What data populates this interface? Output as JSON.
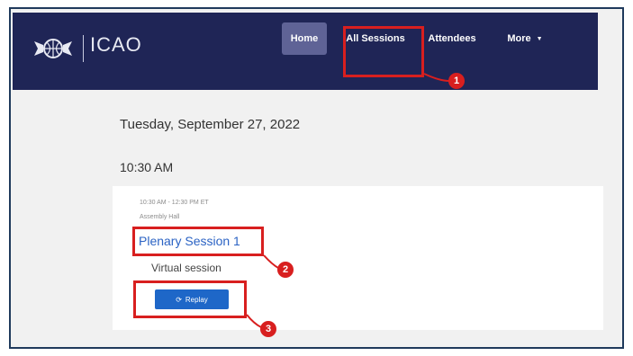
{
  "app": {
    "logo_text": "ICAO",
    "logo_icon": "icao-emblem-icon"
  },
  "nav": {
    "home": "Home",
    "all_sessions": "All Sessions",
    "attendees": "Attendees",
    "more": "More",
    "more_icon": "chevron-down-icon"
  },
  "schedule": {
    "date": "Tuesday, September 27, 2022",
    "time_slot": "10:30 AM",
    "session": {
      "time_range": "10:30 AM - 12:30 PM ET",
      "location": "Assembly Hall",
      "title": "Plenary Session 1",
      "type": "Virtual session",
      "replay_label": "Replay",
      "replay_icon": "replay-icon"
    }
  },
  "annotations": {
    "marker_1": "1",
    "marker_2": "2",
    "marker_3": "3"
  },
  "colors": {
    "navbar": "#1f2556",
    "accent": "#1e67c8",
    "highlight": "#d81f1f",
    "link": "#2b63c4"
  }
}
